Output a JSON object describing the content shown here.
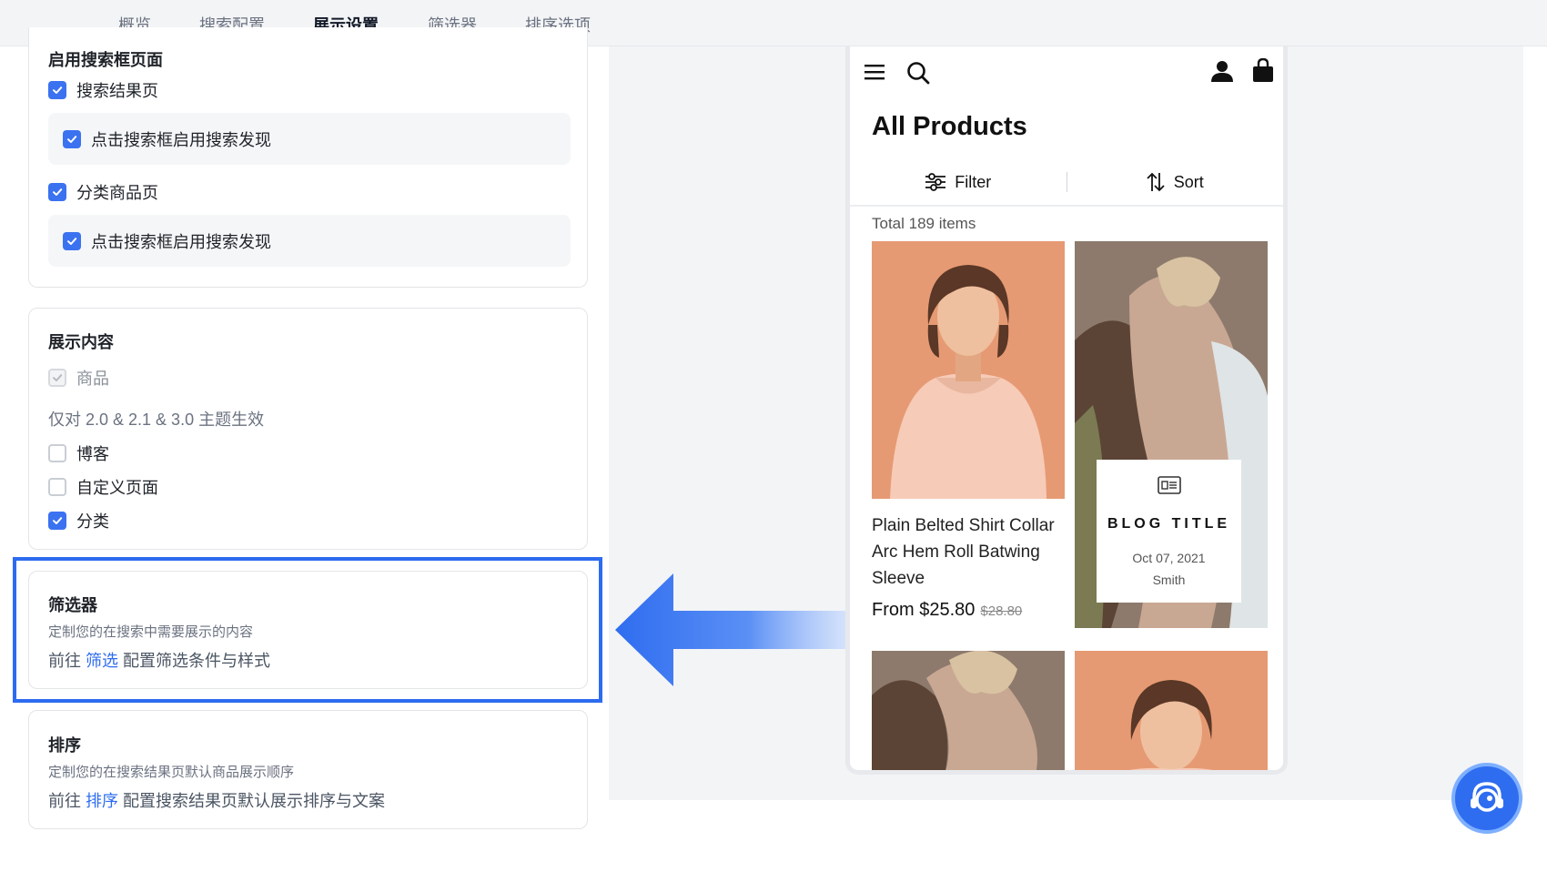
{
  "tabs": [
    {
      "label": "概览"
    },
    {
      "label": "搜索配置"
    },
    {
      "label": "展示设置"
    },
    {
      "label": "筛选器"
    },
    {
      "label": "排序选项"
    }
  ],
  "search_page_section": {
    "title": "启用搜索框页面",
    "items": [
      {
        "label": "搜索结果页",
        "checked": true
      },
      {
        "label": "点击搜索框启用搜索发现",
        "checked": true
      },
      {
        "label": "分类商品页",
        "checked": true
      },
      {
        "label": "点击搜索框启用搜索发现",
        "checked": true
      }
    ]
  },
  "display_content": {
    "title": "展示内容",
    "items": [
      {
        "label": "商品",
        "checked": true,
        "disabled": true
      },
      {
        "label": "博客",
        "checked": false
      },
      {
        "label": "自定义页面",
        "checked": false
      },
      {
        "label": "分类",
        "checked": true
      }
    ],
    "theme_note": "仅对 2.0 & 2.1 & 3.0 主题生效"
  },
  "filter_section": {
    "title": "筛选器",
    "description": "定制您的在搜索中需要展示的内容",
    "goto_prefix": "前往",
    "goto_link": "筛选",
    "goto_suffix": "配置筛选条件与样式"
  },
  "sort_section": {
    "title": "排序",
    "description": "定制您的在搜索结果页默认商品展示顺序",
    "goto_prefix": "前往",
    "goto_link": "排序",
    "goto_suffix": "配置搜索结果页默认展示排序与文案"
  },
  "preview": {
    "page_title": "All Products",
    "filter_label": "Filter",
    "sort_label": "Sort",
    "total_text": "Total 189 items",
    "product": {
      "name": "Plain Belted Shirt Collar Arc Hem Roll Batwing Sleeve",
      "price": "From $25.80",
      "old_price": "$28.80"
    },
    "blog": {
      "title": "BLOG TITLE",
      "date": "Oct 07, 2021",
      "author": "Smith"
    }
  },
  "colors": {
    "accent": "#3b72f0",
    "highlight_border": "#2d6bf0",
    "link": "#2f6df0"
  }
}
